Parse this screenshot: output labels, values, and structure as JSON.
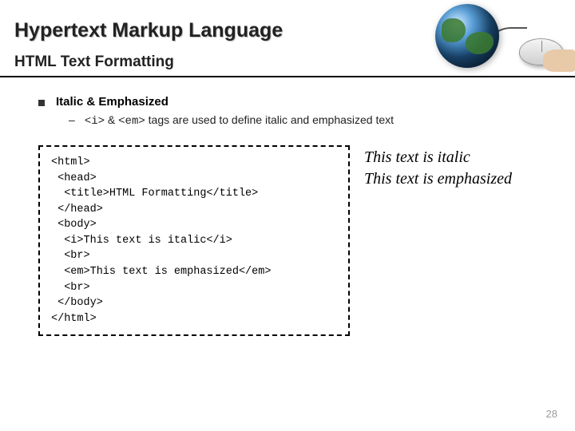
{
  "header": {
    "title": "Hypertext Markup Language",
    "subtitle": "HTML Text Formatting"
  },
  "bullet": {
    "heading": "Italic & Emphasized",
    "sub_prefix": "–",
    "sub_code1": "<i>",
    "sub_amp": " & ",
    "sub_code2": "<em>",
    "sub_rest": " tags are used to define italic and emphasized text"
  },
  "code": "<html>\n <head>\n  <title>HTML Formatting</title>\n </head>\n <body>\n  <i>This text is italic</i>\n  <br>\n  <em>This text is emphasized</em>\n  <br>\n </body>\n</html>",
  "output": {
    "line1": "This text is italic",
    "line2": "This text is emphasized"
  },
  "page_number": "28"
}
